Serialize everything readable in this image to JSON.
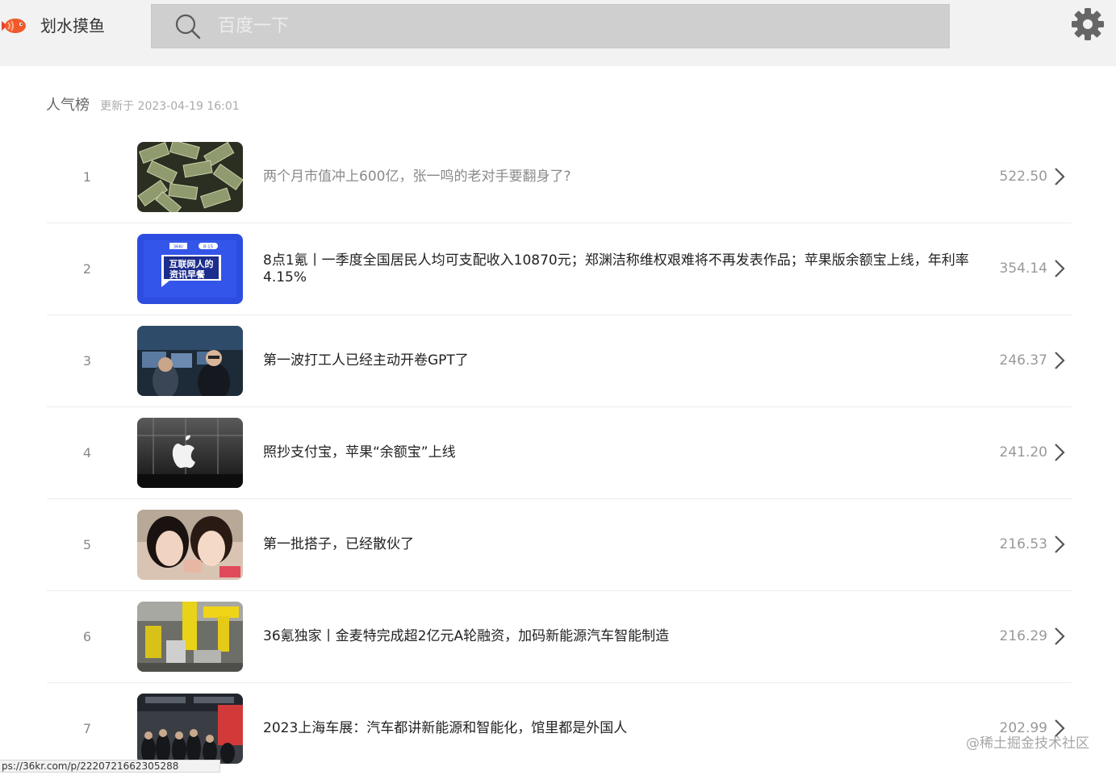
{
  "header": {
    "app_name": "划水摸鱼",
    "search_placeholder": "百度一下",
    "settings_icon": "gear-icon",
    "logo_icon": "fish-icon"
  },
  "section": {
    "title": "人气榜",
    "updated": "更新于 2023-04-19 16:01"
  },
  "items": [
    {
      "rank": "1",
      "title": "两个月市值冲上600亿，张一鸣的老对手要翻身了?",
      "score": "522.50",
      "read": true
    },
    {
      "rank": "2",
      "title": "8点1氪丨一季度全国居民人均可支配收入10870元；郑渊洁称维权艰难将不再发表作品；苹果版余额宝上线，年利率4.15%",
      "score": "354.14",
      "read": false
    },
    {
      "rank": "3",
      "title": "第一波打工人已经主动开卷GPT了",
      "score": "246.37",
      "read": false
    },
    {
      "rank": "4",
      "title": "照抄支付宝，苹果“余额宝”上线",
      "score": "241.20",
      "read": false
    },
    {
      "rank": "5",
      "title": "第一批搭子，已经散伙了",
      "score": "216.53",
      "read": false
    },
    {
      "rank": "6",
      "title": "36氪独家丨金麦特完成超2亿元A轮融资，加码新能源汽车智能制造",
      "score": "216.29",
      "read": false
    },
    {
      "rank": "7",
      "title": "2023上海车展：汽车都讲新能源和智能化，馆里都是外国人",
      "score": "202.99",
      "read": false
    }
  ],
  "thumb_texts": {
    "badge_left": "36Kr",
    "badge_right": "8:15",
    "line1": "互联网人的",
    "line2": "资讯早餐"
  },
  "status_url": "ps://36kr.com/p/2220721662305288",
  "watermark": "@稀土掘金技术社区"
}
